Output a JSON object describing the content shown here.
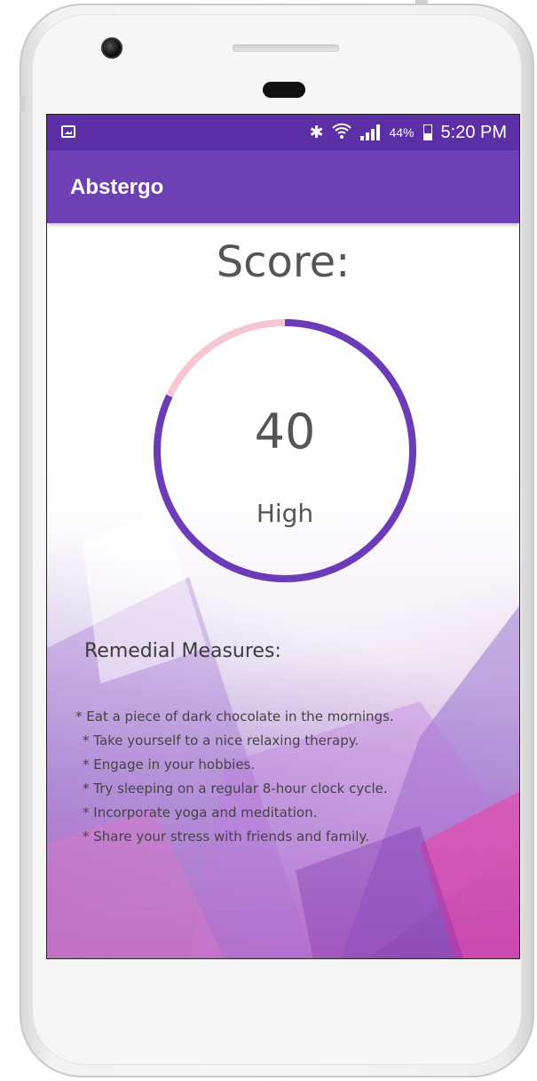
{
  "status_bar": {
    "battery_percent": "44%",
    "time": "5:20 PM",
    "icons": [
      "gallery-notification-icon",
      "bluetooth-icon",
      "wifi-icon",
      "signal-icon",
      "battery-icon"
    ]
  },
  "app_bar": {
    "title": "Abstergo"
  },
  "score": {
    "title": "Score:",
    "value": "40",
    "level": "High",
    "gauge_fraction": 0.82
  },
  "remedial": {
    "title": "Remedial Measures:",
    "items": [
      "* Eat a piece of dark chocolate in the mornings.",
      "* Take yourself to a nice relaxing therapy.",
      "* Engage in your hobbies.",
      "* Try sleeping on a regular 8-hour clock cycle.",
      "* Incorporate yoga and meditation.",
      "* Share your stress with friends and family."
    ]
  },
  "colors": {
    "primary": "#6d40b4",
    "primary_dark": "#5c2fa6",
    "gauge_filled": "#6a3cb8",
    "gauge_track": "#f7c6d3"
  }
}
